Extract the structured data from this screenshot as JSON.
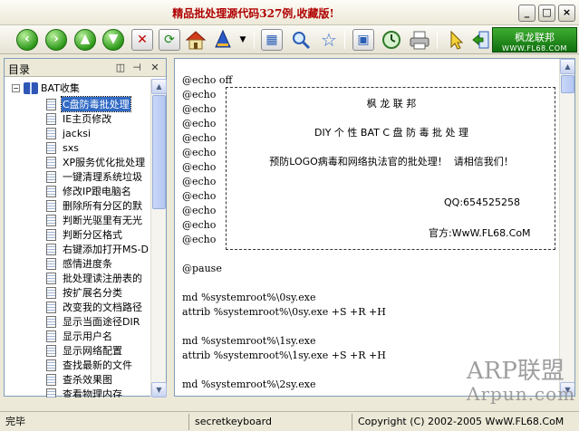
{
  "window": {
    "title": "精品批处理源代码327例,收藏版!",
    "controls": [
      "_",
      "□",
      "×"
    ]
  },
  "toolbar": {
    "icons": [
      "back-icon",
      "forward-icon",
      "up-icon",
      "download-icon",
      "delete-icon",
      "refresh-icon",
      "home-icon",
      "font-icon",
      "view-icon",
      "search-icon",
      "favorite-icon",
      "window-icon",
      "history-icon",
      "print-icon",
      "pointer-icon",
      "exit-icon"
    ],
    "brand_text": "枫龙联邦",
    "brand_url": "WWW.FL68.COM"
  },
  "sidebar": {
    "title": "目录",
    "root": "BAT收集",
    "items": [
      "C盘防毒批处理",
      "IE主页修改",
      "jacksi",
      "sxs",
      "XP服务优化批处理",
      "一键清理系统垃圾",
      "修改IP跟电脑名",
      "删除所有分区的默",
      "判断光驱里有无光",
      "判断分区格式",
      "右键添加打开MS-D",
      "感情进度条",
      "批处理读注册表的",
      "按扩展名分类",
      "改变我的文档路径",
      "显示当面途径DIR",
      "显示用户名",
      "显示网络配置",
      "查找最新的文件",
      "查杀效果图",
      "查看物理内存"
    ],
    "selected_index": 0
  },
  "content": {
    "lines": [
      "@echo off",
      "@echo",
      "@echo",
      "@echo",
      "@echo",
      "@echo",
      "@echo",
      "@echo",
      "@echo",
      "@echo",
      "@echo",
      "@echo",
      "",
      "@pause",
      "",
      "md %systemroot%\\0sy.exe",
      "attrib %systemroot%\\0sy.exe +S +R +H",
      "",
      "md %systemroot%\\1sy.exe",
      "attrib %systemroot%\\1sy.exe +S +R +H",
      "",
      "md %systemroot%\\2sy.exe"
    ],
    "box": {
      "title": "枫 龙 联 邦",
      "subtitle": "DIY 个 性 BAT C 盘 防 毒 批 处 理",
      "message": "预防LOGO病毒和网络执法官的批处理！  请相信我们！",
      "qq": "QQ:654525258",
      "site": "官方:WwW.FL68.CoM"
    }
  },
  "status": {
    "left": "完毕",
    "middle": "secretkeyboard",
    "right": "Copyright (C) 2002-2005 WwW.FL68.CoM"
  },
  "watermark": {
    "line1": "ARP联盟",
    "line2": "Arpun.com"
  }
}
